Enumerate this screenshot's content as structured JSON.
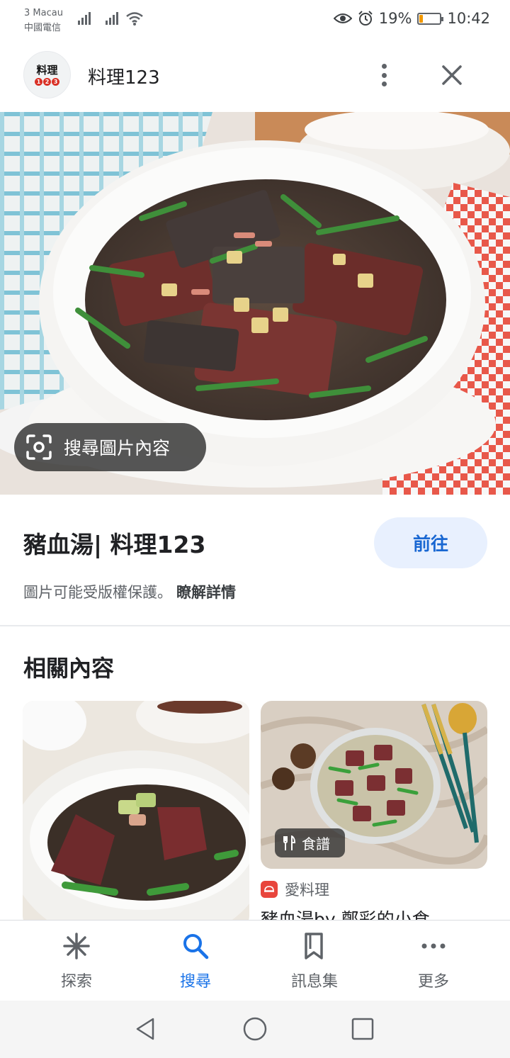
{
  "status_bar": {
    "carrier_line1": "3 Macau",
    "carrier_line2": "中國電信",
    "battery_percent": "19%",
    "battery_level": 0.19,
    "time": "10:42",
    "icons": [
      "signal-icon",
      "signal-icon",
      "wifi-icon",
      "eye-icon",
      "alarm-icon",
      "battery-icon"
    ]
  },
  "header": {
    "logo_text": "料理",
    "logo_digits": [
      "1",
      "2",
      "3"
    ],
    "site_name": "料理123",
    "menu_icon": "more-vert-icon",
    "close_icon": "close-icon"
  },
  "hero": {
    "lens_label": "搜尋圖片內容",
    "lens_icon": "lens-icon"
  },
  "info": {
    "title": "豬血湯| 料理123",
    "visit_label": "前往",
    "copyright_text": "圖片可能受版權保護。",
    "learn_more": "瞭解詳情"
  },
  "related": {
    "heading": "相關內容",
    "cards": [
      {
        "chip": "食譜",
        "chip_icon": "restaurant-icon",
        "source": "愛料理",
        "title": "豬血湯by 鄭彩的小食"
      }
    ]
  },
  "bottom_nav": {
    "items": [
      {
        "label": "探索",
        "icon": "asterisk-icon",
        "active": false
      },
      {
        "label": "搜尋",
        "icon": "search-icon",
        "active": true
      },
      {
        "label": "訊息集",
        "icon": "collections-icon",
        "active": false
      },
      {
        "label": "更多",
        "icon": "more-horiz-icon",
        "active": false
      }
    ]
  },
  "colors": {
    "accent": "#1a73e8",
    "visit_button_bg": "#e8f0fe",
    "battery_fill": "#f29900"
  }
}
